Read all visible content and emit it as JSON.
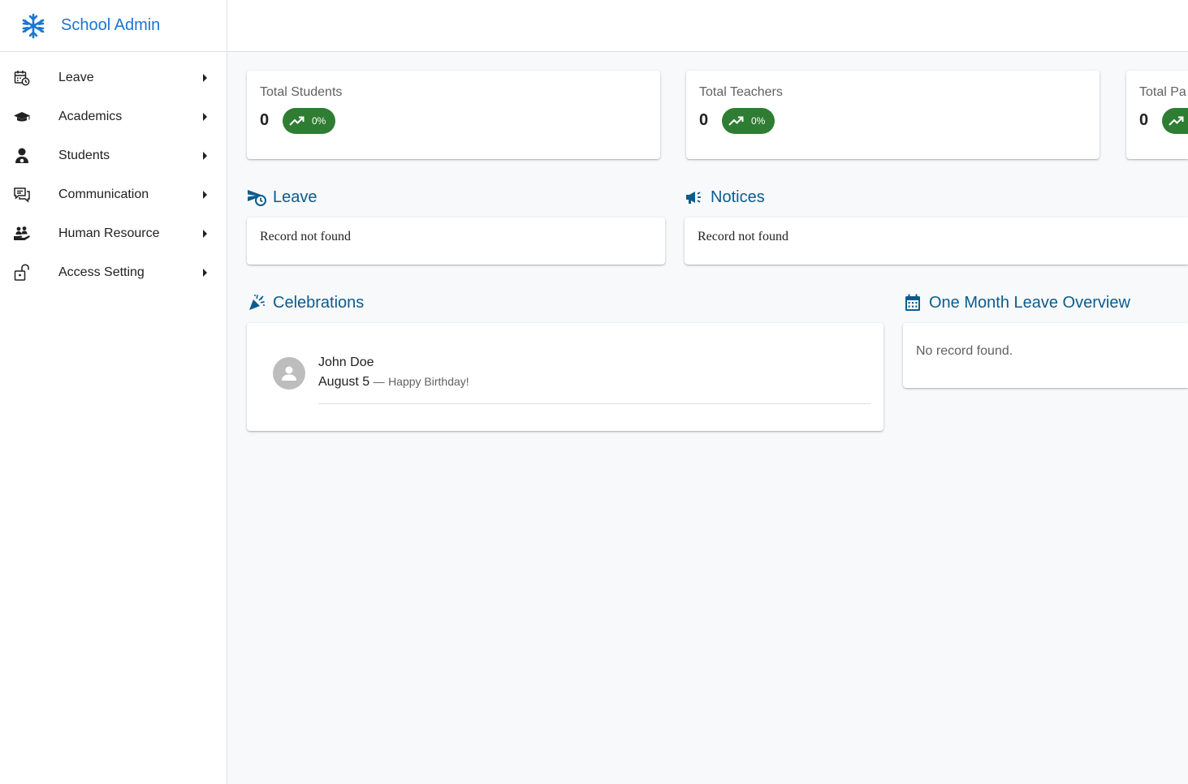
{
  "brand": {
    "name": "School Admin",
    "icon": "snowflake-icon"
  },
  "sidebar": {
    "items": [
      {
        "label": "Leave",
        "icon": "calendar-clock-icon"
      },
      {
        "label": "Academics",
        "icon": "graduation-cap-icon"
      },
      {
        "label": "Students",
        "icon": "student-icon"
      },
      {
        "label": "Communication",
        "icon": "chat-bubbles-icon"
      },
      {
        "label": "Human Resource",
        "icon": "hand-people-icon"
      },
      {
        "label": "Access Setting",
        "icon": "unlock-icon"
      }
    ]
  },
  "stats": [
    {
      "title": "Total Students",
      "value": "0",
      "change": "0%"
    },
    {
      "title": "Total Teachers",
      "value": "0",
      "change": "0%"
    },
    {
      "title": "Total Pa",
      "value": "0",
      "change": ""
    }
  ],
  "leave": {
    "title": "Leave",
    "empty": "Record not found"
  },
  "notices": {
    "title": "Notices",
    "empty": "Record not found"
  },
  "celebrations": {
    "title": "Celebrations",
    "items": [
      {
        "name": "John Doe",
        "date": "August 5",
        "separator": "—",
        "message": "Happy Birthday!"
      }
    ]
  },
  "leave_overview": {
    "title": "One Month Leave Overview",
    "empty": "No record found."
  },
  "colors": {
    "brand": "#1976d2",
    "section_heading": "#0b5c8e",
    "chip": "#2e7d32"
  }
}
